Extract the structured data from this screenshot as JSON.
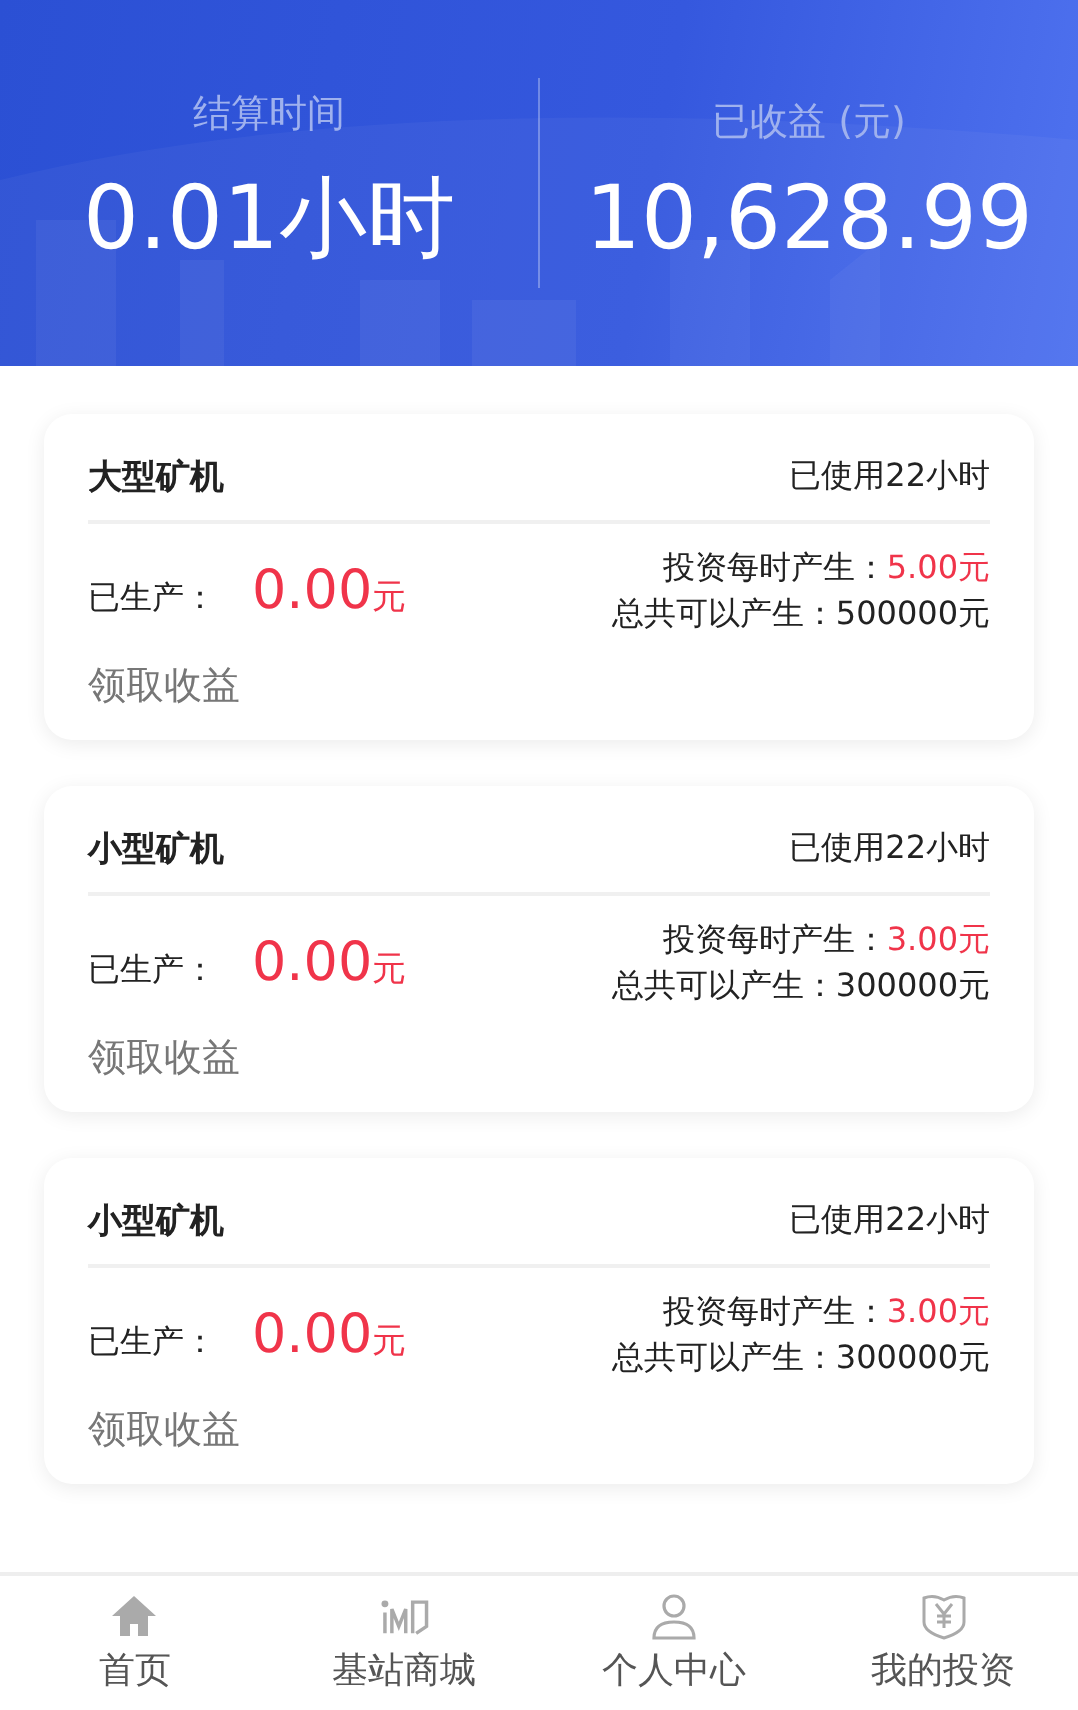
{
  "summary": [
    {
      "label": "结算时间",
      "value": "0.01小时"
    },
    {
      "label": "已收益 (元)",
      "value": "10,628.99"
    }
  ],
  "machines": [
    {
      "name": "大型矿机",
      "usage": "已使用22小时",
      "produced_label": "已生产：",
      "produced_value": "0.00",
      "produced_unit": "元",
      "rate_label": "投资每时产生：",
      "rate_value": "5.00元",
      "total": "总共可以产生：500000元",
      "claim": "领取收益"
    },
    {
      "name": "小型矿机",
      "usage": "已使用22小时",
      "produced_label": "已生产：",
      "produced_value": "0.00",
      "produced_unit": "元",
      "rate_label": "投资每时产生：",
      "rate_value": "3.00元",
      "total": "总共可以产生：300000元",
      "claim": "领取收益"
    },
    {
      "name": "小型矿机",
      "usage": "已使用22小时",
      "produced_label": "已生产：",
      "produced_value": "0.00",
      "produced_unit": "元",
      "rate_label": "投资每时产生：",
      "rate_value": "3.00元",
      "total": "总共可以产生：300000元",
      "claim": "领取收益"
    }
  ],
  "tabs": [
    {
      "label": "首页",
      "selected": false
    },
    {
      "label": "基站商城",
      "selected": false
    },
    {
      "label": "个人中心",
      "selected": false
    },
    {
      "label": "我的投资",
      "selected": false
    }
  ]
}
